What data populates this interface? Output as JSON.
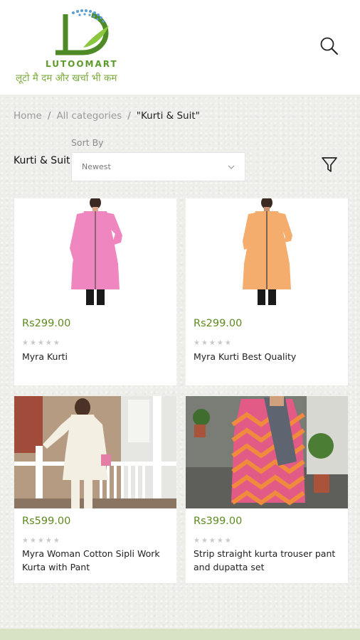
{
  "header": {
    "brand_name": "LUTOOMART",
    "tagline": "लूटो मै दम और खर्चा भी कम",
    "logo_letter": "D"
  },
  "breadcrumb": {
    "home": "Home",
    "sep1": "/",
    "all_categories": "All categories",
    "sep2": "/",
    "current": "\"Kurti & Suit\""
  },
  "listing": {
    "category_title": "Kurti & Suit",
    "sort_label": "Sort By",
    "sort_value": "Newest"
  },
  "colors": {
    "accent_green": "#5d8a1f",
    "brand_green": "#5d9a2c"
  },
  "products": [
    {
      "price": "Rs299.00",
      "name": "Myra Kurti",
      "rating": 0,
      "stars": "★★★★★"
    },
    {
      "price": "Rs299.00",
      "name": "Myra Kurti Best Quality",
      "rating": 0,
      "stars": "★★★★★"
    },
    {
      "price": "Rs599.00",
      "name": "Myra Woman Cotton Sipli Work Kurta with Pant",
      "rating": 0,
      "stars": "★★★★★"
    },
    {
      "price": "Rs399.00",
      "name": "Strip straight kurta trouser pant and dupatta set",
      "rating": 0,
      "stars": "★★★★★"
    }
  ]
}
